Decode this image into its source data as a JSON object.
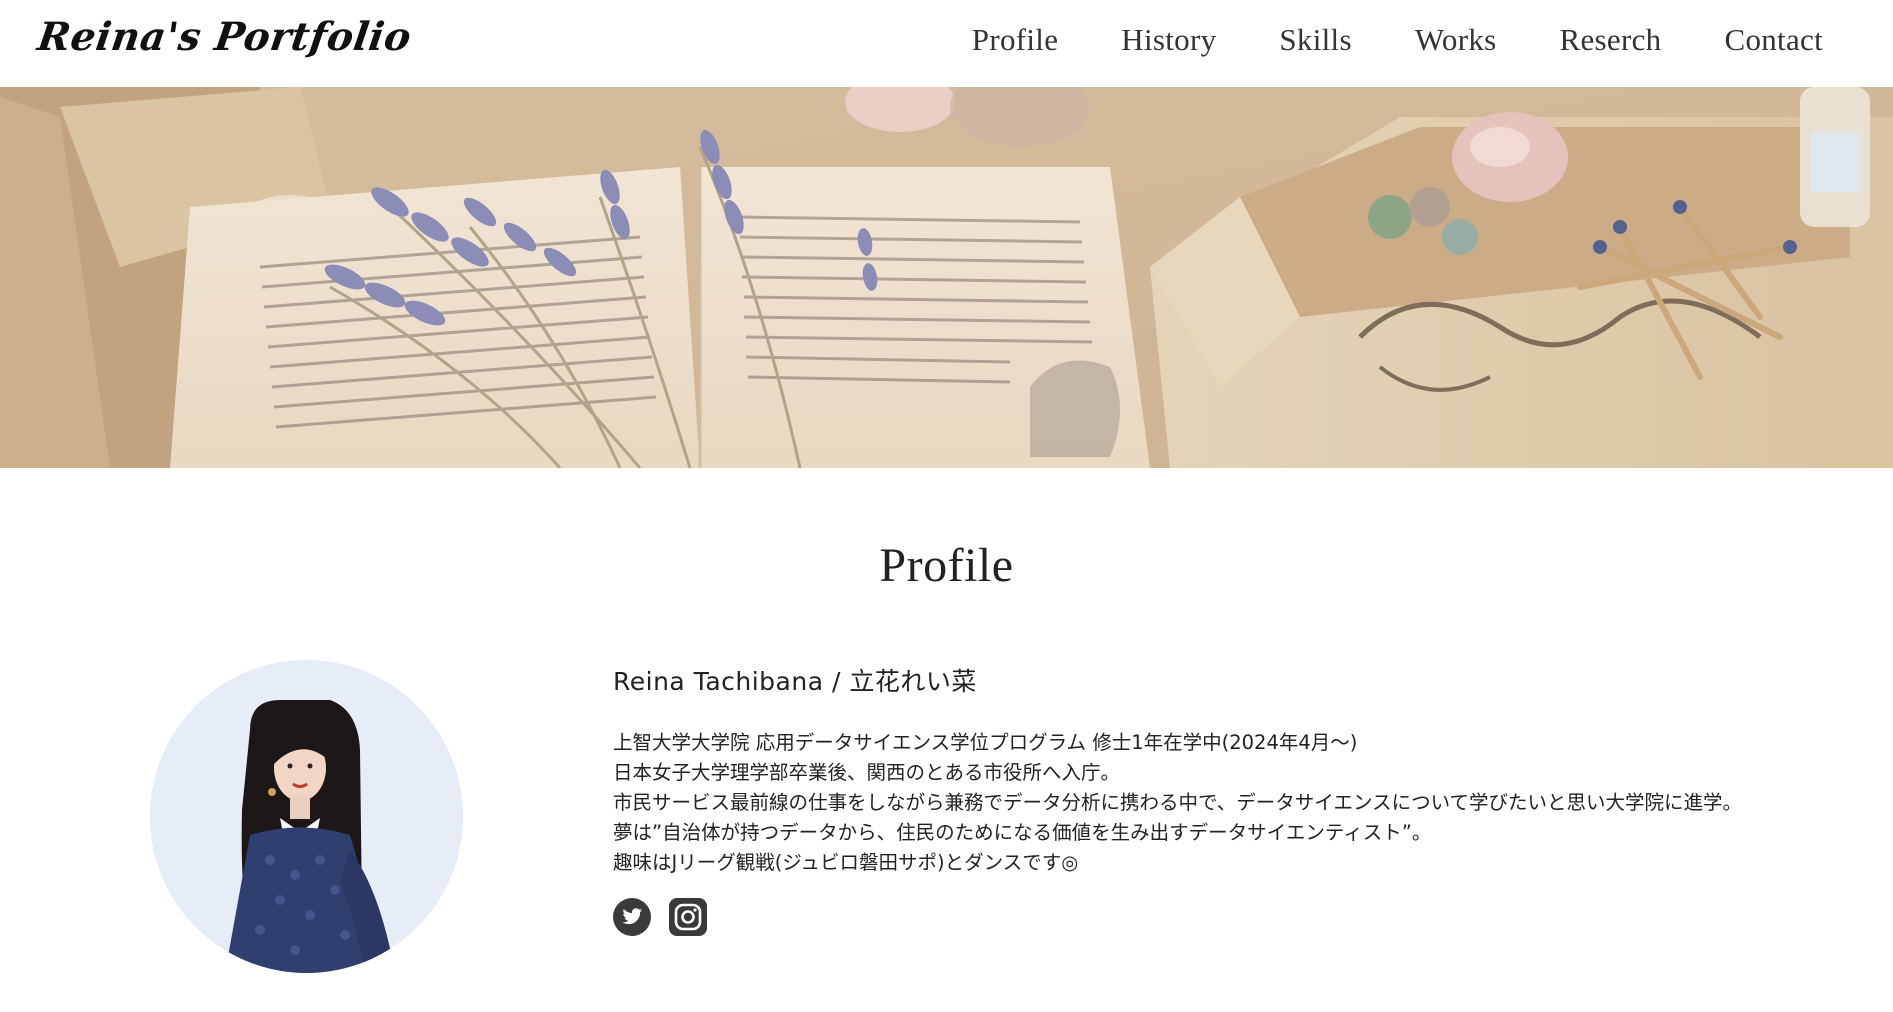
{
  "header": {
    "logo": "Reina's Portfolio",
    "nav": [
      {
        "label": "Profile"
      },
      {
        "label": "History"
      },
      {
        "label": "Skills"
      },
      {
        "label": "Works"
      },
      {
        "label": "Reserch"
      },
      {
        "label": "Contact"
      }
    ]
  },
  "hero": {
    "image": "photo-header-open-book-lavender-wooden-box"
  },
  "profile": {
    "title": "Profile",
    "avatar": "profile-photo",
    "name": "Reina Tachibana / 立花れい菜",
    "bio": [
      "上智大学大学院 応用データサイエンス学位プログラム 修士1年在学中(2024年4月〜)",
      "日本女子大学理学部卒業後、関西のとある市役所へ入庁。",
      "市民サービス最前線の仕事をしながら兼務でデータ分析に携わる中で、データサイエンスについて学びたいと思い大学院に進学。",
      "夢は”自治体が持つデータから、住民のためになる価値を生み出すデータサイエンティスト”。",
      "趣味はJリーグ観戦(ジュビロ磐田サポ)とダンスです◎"
    ],
    "social": [
      {
        "icon": "twitter-icon"
      },
      {
        "icon": "instagram-icon"
      }
    ]
  },
  "colors": {
    "text": "#222222",
    "icon": "#3a3a3a",
    "avatar_bg": "#e7edf6"
  }
}
